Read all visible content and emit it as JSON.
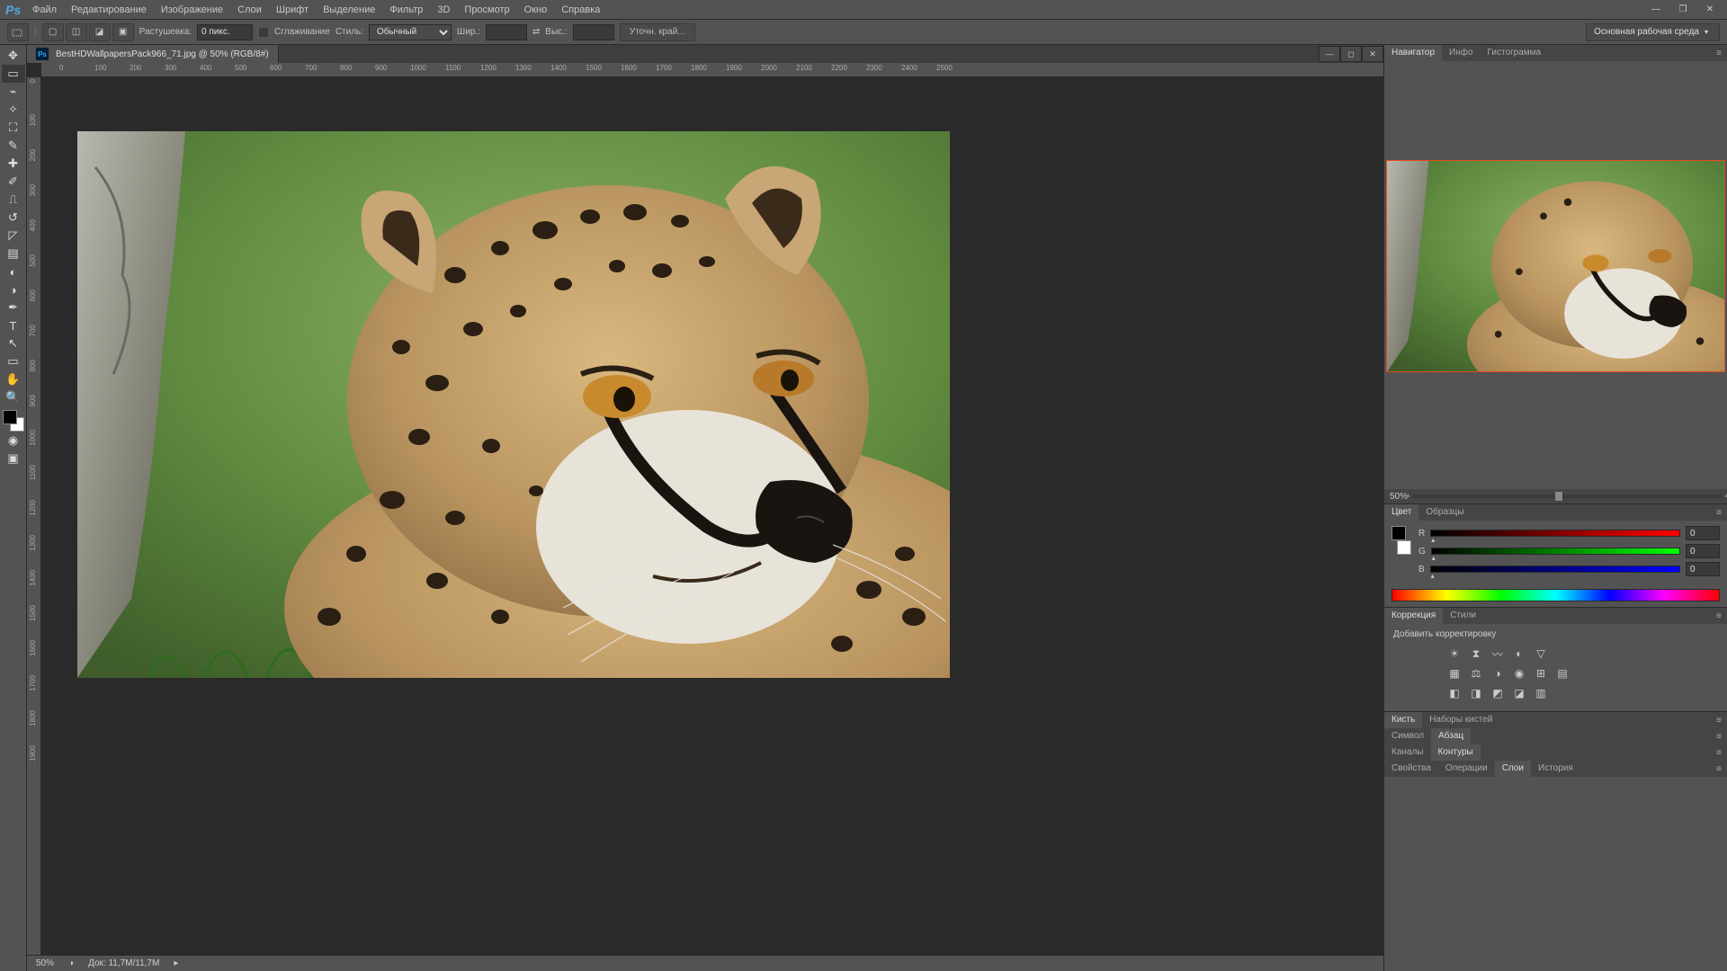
{
  "menu": {
    "items": [
      "Файл",
      "Редактирование",
      "Изображение",
      "Слои",
      "Шрифт",
      "Выделение",
      "Фильтр",
      "3D",
      "Просмотр",
      "Окно",
      "Справка"
    ]
  },
  "options": {
    "feather_label": "Растушевка:",
    "feather_value": "0 пикс.",
    "antialias_label": "Сглаживание",
    "style_label": "Стиль:",
    "style_value": "Обычный",
    "width_label": "Шир.:",
    "height_label": "Выс.:",
    "refine_label": "Уточн. край...",
    "workspace": "Основная рабочая среда"
  },
  "doc": {
    "title": "BestHDWallpapersPack966_71.jpg @ 50% (RGB/8#)",
    "zoom": "50%",
    "docsize": "Док: 11,7M/11,7M"
  },
  "panels": {
    "navigator": {
      "tabs": [
        "Навигатор",
        "Инфо",
        "Гистограмма"
      ],
      "zoom": "50%"
    },
    "color": {
      "tabs": [
        "Цвет",
        "Образцы"
      ],
      "r_label": "R",
      "g_label": "G",
      "b_label": "B",
      "r_val": "0",
      "g_val": "0",
      "b_val": "0"
    },
    "adjust": {
      "tabs": [
        "Коррекция",
        "Стили"
      ],
      "label": "Добавить корректировку"
    },
    "brush": {
      "tabs": [
        "Кисть",
        "Наборы кистей"
      ]
    },
    "char": {
      "tabs": [
        "Символ",
        "Абзац"
      ]
    },
    "channels": {
      "tabs": [
        "Каналы",
        "Контуры"
      ]
    },
    "props": {
      "tabs": [
        "Свойства",
        "Операции",
        "Слои",
        "История"
      ]
    }
  },
  "ruler_h": [
    "0",
    "100",
    "200",
    "300",
    "400",
    "500",
    "600",
    "700",
    "800",
    "900",
    "1000",
    "1100",
    "1200",
    "1300",
    "1400",
    "1500",
    "1600",
    "1700",
    "1800",
    "1900",
    "2000",
    "2100",
    "2200",
    "2300",
    "2400",
    "2500"
  ],
  "ruler_v": [
    "0",
    "100",
    "200",
    "300",
    "400",
    "500",
    "600",
    "700",
    "800",
    "900",
    "1000",
    "1100",
    "1200",
    "1300",
    "1400",
    "1500",
    "1600",
    "1700",
    "1800",
    "1900"
  ]
}
